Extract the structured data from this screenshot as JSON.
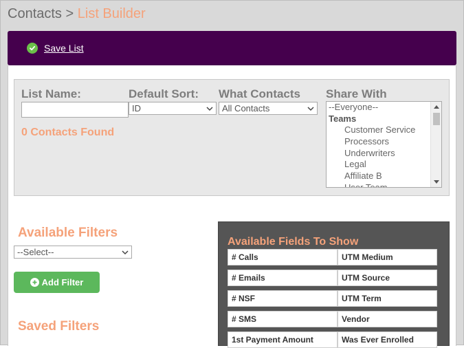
{
  "breadcrumb": {
    "parent": "Contacts",
    "separator": ">",
    "current": "List Builder"
  },
  "toolbar": {
    "save_label": "Save List"
  },
  "form": {
    "list_name_label": "List Name:",
    "list_name_value": "",
    "default_sort_label": "Default Sort:",
    "default_sort_value": "ID",
    "what_contacts_label": "What Contacts",
    "what_contacts_value": "All Contacts",
    "share_with_label": "Share With",
    "contacts_found": "0 Contacts Found"
  },
  "share_with": {
    "items": [
      {
        "label": "--Everyone--",
        "type": "option"
      },
      {
        "label": "Teams",
        "type": "group"
      },
      {
        "label": "Customer Service",
        "type": "sub"
      },
      {
        "label": "Processors",
        "type": "sub"
      },
      {
        "label": "Underwriters",
        "type": "sub"
      },
      {
        "label": "Legal",
        "type": "sub"
      },
      {
        "label": "Affiliate B",
        "type": "sub"
      },
      {
        "label": "User Team",
        "type": "sub"
      }
    ]
  },
  "filters": {
    "available_title": "Available Filters",
    "select_value": "--Select--",
    "add_button_label": "Add Filter",
    "saved_title": "Saved Filters"
  },
  "fields": {
    "title": "Available Fields To Show",
    "items": [
      "# Calls",
      "UTM Medium",
      "# Emails",
      "UTM Source",
      "# NSF",
      "UTM Term",
      "# SMS",
      "Vendor",
      "1st Payment Amount",
      "Was Ever Enrolled"
    ]
  },
  "colors": {
    "accent": "#f5a27a",
    "savebar": "#45004d",
    "button": "#5cb85c"
  }
}
